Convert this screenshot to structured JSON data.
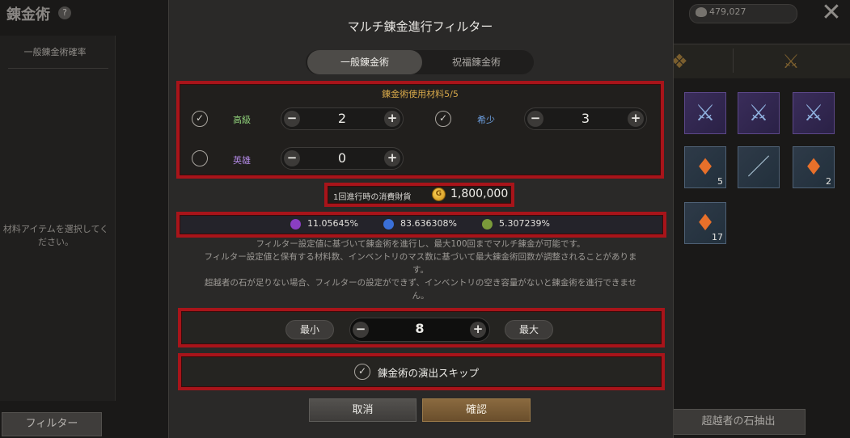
{
  "background": {
    "screen_title": "錬金術",
    "help_glyph": "?",
    "left_panel_title": "一般錬金術確率",
    "left_panel_hint": "材料アイテムを選択してください。",
    "filter_button": "フィルター",
    "gold_amount": "479,027",
    "extract_button": "超越者の石抽出",
    "inventory": [
      {
        "kind": "weapon",
        "count": ""
      },
      {
        "kind": "weapon",
        "count": ""
      },
      {
        "kind": "weapon",
        "count": ""
      },
      {
        "kind": "rune",
        "count": "5"
      },
      {
        "kind": "staff",
        "count": ""
      },
      {
        "kind": "rune",
        "count": "2"
      },
      {
        "kind": "rune",
        "count": "17"
      }
    ]
  },
  "modal": {
    "title": "マルチ錬金進行フィルター",
    "tabs": [
      "一般錬金術",
      "祝福錬金術"
    ],
    "active_tab": 0,
    "materials_title": "錬金術使用材料5/5",
    "grades": [
      {
        "label": "高級",
        "checked": true,
        "value": "2",
        "color": "#8fd07a"
      },
      {
        "label": "希少",
        "checked": true,
        "value": "3",
        "color": "#6fa3e6"
      },
      {
        "label": "英雄",
        "checked": false,
        "value": "0",
        "color": "#b38ae6"
      }
    ],
    "cost_label": "1回進行時の消費財貨",
    "cost_value": "1,800,000",
    "coin_glyph": "G",
    "probabilities": [
      {
        "value": "11.05645%",
        "color": "#8a3ec2"
      },
      {
        "value": "83.636308%",
        "color": "#3a6fd8"
      },
      {
        "value": "5.307239%",
        "color": "#7a9a3a"
      }
    ],
    "info_lines": [
      "フィルター設定値に基づいて錬金術を進行し、最大100回までマルチ錬金が可能です。",
      "フィルター設定値と保有する材料数、インベントリのマス数に基づいて最大錬金術回数が調整されることがありま",
      "す。",
      "超越者の石が足りない場合、フィルターの設定ができず、インベントリの空き容量がないと錬金術を進行できませ",
      "ん。"
    ],
    "min_label": "最小",
    "max_label": "最大",
    "count_value": "8",
    "skip_label": "錬金術の演出スキップ",
    "skip_checked": true,
    "cancel_label": "取消",
    "confirm_label": "確認"
  }
}
